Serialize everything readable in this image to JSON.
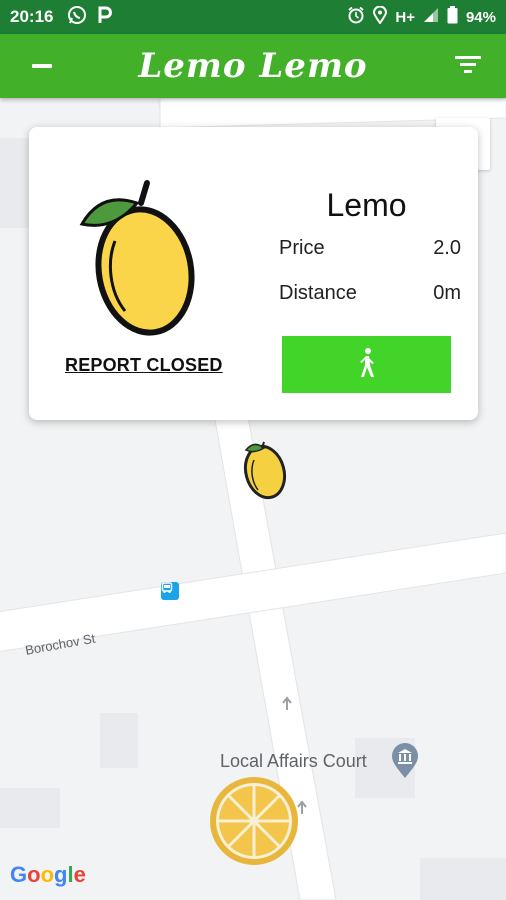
{
  "status_bar": {
    "time": "20:16",
    "network": "H+",
    "battery": "94%",
    "icons": [
      "whatsapp-icon",
      "parking-app-icon",
      "alarm-icon",
      "location-icon",
      "signal-icon",
      "battery-icon"
    ]
  },
  "app_bar": {
    "title": "Lemo Lemo",
    "left_icon": "minus-menu-icon",
    "right_icon": "filter-icon",
    "color": "#43b02a"
  },
  "card": {
    "name": "Lemo",
    "price_label": "Price",
    "price_value": "2.0",
    "distance_label": "Distance",
    "distance_value": "0m",
    "report_label": "REPORT CLOSED",
    "action_icon": "walking-person-icon",
    "action_color": "#43d42a"
  },
  "map": {
    "street_label": "Borochov St",
    "poi_label": "Local Affairs Court",
    "poi_icon": "courthouse-icon",
    "transit_icon": "bus-stop-icon",
    "marker_icon": "lemon-marker-icon",
    "location_icon": "lemon-slice-location-icon",
    "attribution": "Google"
  }
}
